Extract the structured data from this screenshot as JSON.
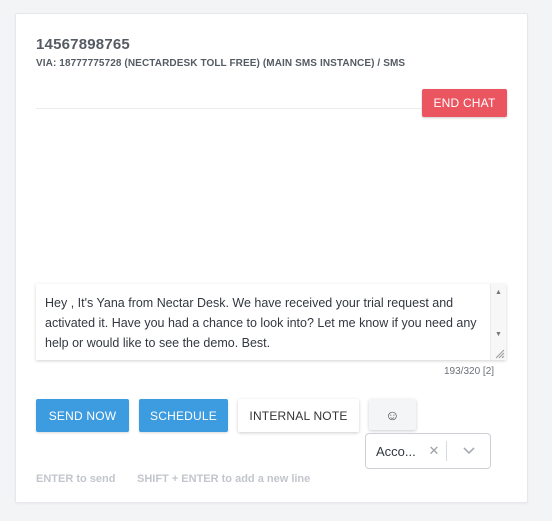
{
  "conversation": {
    "contact_number": "14567898765",
    "via_line": "VIA: 18777775728 (NECTARDESK TOLL FREE) (MAIN SMS INSTANCE) / SMS",
    "end_chat_label": "END CHAT"
  },
  "composer": {
    "message_text": "Hey , It's Yana from Nectar Desk. We have received your trial request and activated it. Have you had a chance to look into? Let me know if you need any help or would like to see the demo. Best.",
    "char_counter": "193/320 [2]"
  },
  "actions": {
    "send_now_label": "SEND NOW",
    "schedule_label": "SCHEDULE",
    "internal_note_label": "INTERNAL NOTE",
    "emoji_label": "☺"
  },
  "account_select": {
    "value": "Acco...",
    "clear_glyph": "✕"
  },
  "hints": {
    "enter": "ENTER to send",
    "shift_enter": "SHIFT + ENTER to add a new line"
  },
  "colors": {
    "end_chat": "#ea5560",
    "primary": "#3d9be0"
  },
  "icons": {
    "emoji": "smiley-icon",
    "clear": "close-icon",
    "dropdown": "chevron-down-icon"
  }
}
